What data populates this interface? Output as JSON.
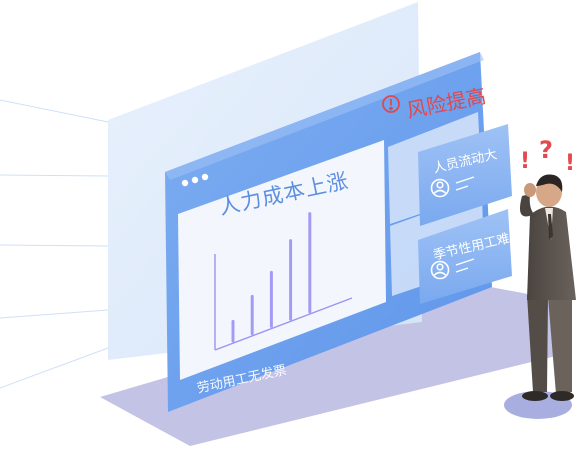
{
  "alert": {
    "text": "风险提高",
    "color": "#e0484e",
    "icon": "exclamation-circle-icon"
  },
  "chart": {
    "title": "人力成本上涨"
  },
  "chart_data": {
    "type": "bar",
    "title": "人力成本上涨",
    "categories": [
      "",
      "",
      "",
      "",
      ""
    ],
    "values": [
      20,
      38,
      55,
      80,
      100
    ],
    "ylim": [
      0,
      110
    ],
    "color": "#a39cf4"
  },
  "footer": {
    "text": "劳动用工无发票"
  },
  "issues": [
    {
      "label": "人员流动大",
      "icon": "user-avatar-icon"
    },
    {
      "label": "季节性用工难",
      "icon": "user-avatar-icon"
    }
  ],
  "person": {
    "icon": "confused-man-icon",
    "marks": "!?!"
  },
  "window": {
    "dots_icon": "window-dots-icon"
  },
  "colors": {
    "panel": "#d9e7fa",
    "frame": "#6fa3ef",
    "card": "#8bb6f3",
    "floor": "#b8b8e0"
  }
}
